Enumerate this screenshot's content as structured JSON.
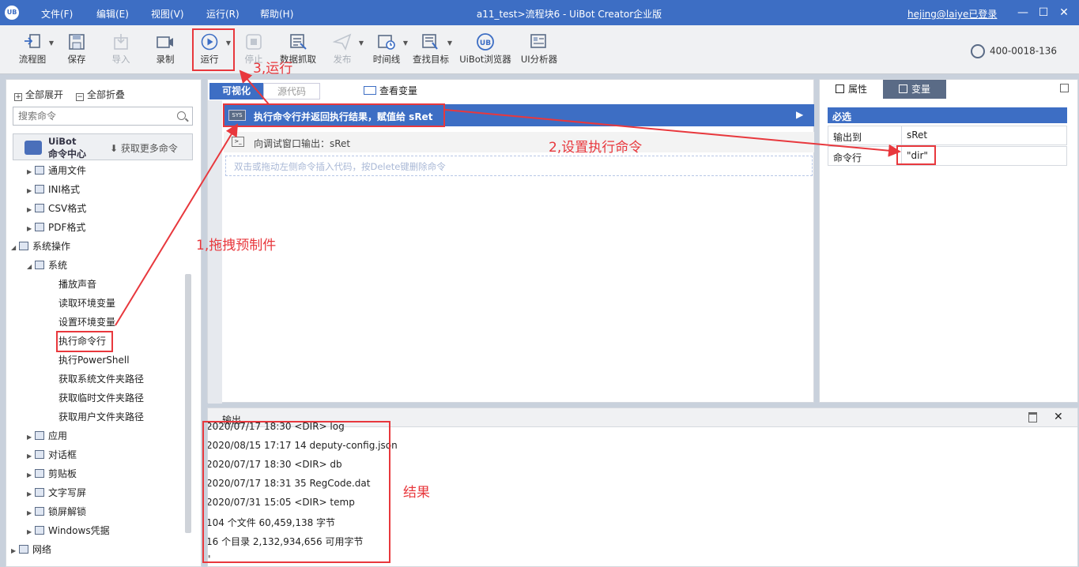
{
  "titlebar": {
    "logo": "UB",
    "menu": [
      "文件(F)",
      "编辑(E)",
      "视图(V)",
      "运行(R)",
      "帮助(H)"
    ],
    "window_title": "a11_test>流程块6 - UiBot Creator企业版",
    "user": "hejing@laiye已登录"
  },
  "toolbar": {
    "buttons": [
      {
        "label": "流程图",
        "icon": "flowchart-icon",
        "enabled": true,
        "dropdown": true
      },
      {
        "label": "保存",
        "icon": "save-icon",
        "enabled": true
      },
      {
        "label": "导入",
        "icon": "import-icon",
        "enabled": false
      },
      {
        "label": "录制",
        "icon": "record-icon",
        "enabled": true
      },
      {
        "label": "运行",
        "icon": "run-icon",
        "enabled": true,
        "dropdown": true
      },
      {
        "label": "停止",
        "icon": "stop-icon",
        "enabled": false
      },
      {
        "label": "数据抓取",
        "icon": "data-scrape-icon",
        "enabled": true
      },
      {
        "label": "发布",
        "icon": "publish-icon",
        "enabled": false,
        "dropdown": true
      },
      {
        "label": "时间线",
        "icon": "timeline-icon",
        "enabled": true,
        "dropdown": true
      },
      {
        "label": "查找目标",
        "icon": "find-target-icon",
        "enabled": true,
        "dropdown": true
      },
      {
        "label": "UiBot浏览器",
        "icon": "uibot-browser-icon",
        "enabled": true
      },
      {
        "label": "UI分析器",
        "icon": "ui-analyzer-icon",
        "enabled": true
      }
    ],
    "phone": "400-0018-136"
  },
  "left": {
    "expand_all": "全部展开",
    "collapse_all": "全部折叠",
    "search_placeholder": "搜索命令",
    "cmd_center_line1": "UiBot",
    "cmd_center_line2": "命令中心",
    "get_more": "获取更多命令",
    "tree": [
      {
        "label": "通用文件",
        "level": 1,
        "arrow": "▶"
      },
      {
        "label": "INI格式",
        "level": 1,
        "arrow": "▶"
      },
      {
        "label": "CSV格式",
        "level": 1,
        "arrow": "▶"
      },
      {
        "label": "PDF格式",
        "level": 1,
        "arrow": "▶"
      },
      {
        "label": "系统操作",
        "level": 0,
        "arrow": "◢"
      },
      {
        "label": "系统",
        "level": 1,
        "arrow": "◢"
      },
      {
        "label": "播放声音",
        "level": 2,
        "arrow": ""
      },
      {
        "label": "读取环境变量",
        "level": 2,
        "arrow": ""
      },
      {
        "label": "设置环境变量",
        "level": 2,
        "arrow": ""
      },
      {
        "label": "执行命令行",
        "level": 2,
        "arrow": ""
      },
      {
        "label": "执行PowerShell",
        "level": 2,
        "arrow": ""
      },
      {
        "label": "获取系统文件夹路径",
        "level": 2,
        "arrow": ""
      },
      {
        "label": "获取临时文件夹路径",
        "level": 2,
        "arrow": ""
      },
      {
        "label": "获取用户文件夹路径",
        "level": 2,
        "arrow": ""
      },
      {
        "label": "应用",
        "level": 1,
        "arrow": "▶"
      },
      {
        "label": "对话框",
        "level": 1,
        "arrow": "▶"
      },
      {
        "label": "剪贴板",
        "level": 1,
        "arrow": "▶"
      },
      {
        "label": "文字写屏",
        "level": 1,
        "arrow": "▶"
      },
      {
        "label": "锁屏解锁",
        "level": 1,
        "arrow": "▶"
      },
      {
        "label": "Windows凭据",
        "level": 1,
        "arrow": "▶"
      },
      {
        "label": "网络",
        "level": 0,
        "arrow": "▶"
      }
    ]
  },
  "editor": {
    "tab_visual": "可视化",
    "tab_source": "源代码",
    "view_vars": "查看变量",
    "selected_cmd": "执行命令行并返回执行结果，赋值给 sRet",
    "cmd2": "向调试窗口输出：sRet",
    "dropzone": "双击或拖动左侧命令插入代码，按Delete键删除命令"
  },
  "props": {
    "tab_attr": "属性",
    "tab_var": "变量",
    "required": "必选",
    "rows": [
      {
        "label": "输出到",
        "value": "sRet"
      },
      {
        "label": "命令行",
        "value": "\"dir\""
      }
    ]
  },
  "output": {
    "title": "输出",
    "lines": [
      "2020/07/17 18:30 <DIR> log",
      "2020/08/15 17:17 14 deputy-config.json",
      "2020/07/17 18:30 <DIR> db",
      "2020/07/17 18:31 35 RegCode.dat",
      "2020/07/31 15:05 <DIR> temp",
      "104 个文件 60,459,138 字节",
      "16 个目录 2,132,934,656 可用字节",
      "\""
    ]
  },
  "annotations": {
    "step1": "1,拖拽预制件",
    "step2": "2,设置执行命令",
    "step3": "3,运行",
    "result": "结果",
    "color": "#e8383d"
  }
}
